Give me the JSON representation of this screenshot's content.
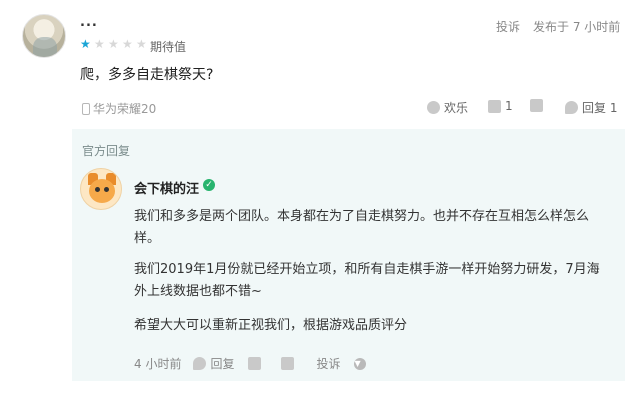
{
  "review": {
    "username": "...",
    "rating": 1,
    "rating_max": 5,
    "rating_label": "期待值",
    "report_label": "投诉",
    "time": "发布于 7 小时前",
    "text": "爬，多多自走棋祭天?",
    "device": "华为荣耀20",
    "actions": {
      "happy_label": "欢乐",
      "like_count": "1",
      "reply_label": "回复 1"
    }
  },
  "official_reply": {
    "title": "官方回复",
    "author": "会下棋的汪",
    "paragraphs": [
      "我们和多多是两个团队。本身都在为了自走棋努力。也并不存在互相怎么样怎么",
      "样。",
      "我们2019年1月份就已经开始立项，和所有自走棋手游一样开始努力研发，7月海",
      "外上线数据也都不错~",
      "希望大大可以重新正视我们，根据游戏品质评分"
    ],
    "footer": {
      "time": "4 小时前",
      "reply_label": "回复",
      "report_label": "投诉"
    }
  },
  "colors": {
    "star_on": "#1aa5d6",
    "star_off": "#d8d8d8",
    "reply_bg": "#f1f8f8",
    "verified": "#28b46e"
  }
}
